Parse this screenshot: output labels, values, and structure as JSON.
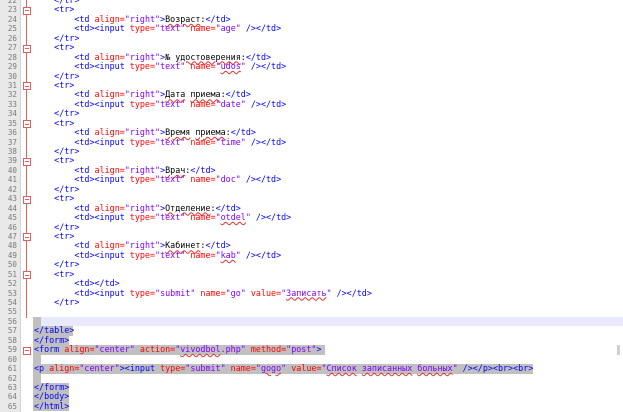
{
  "editor": {
    "lines": [
      {
        "num": "22",
        "marker": "none",
        "hl": "none",
        "sel_w": 0,
        "tokens": [
          {
            "c": "",
            "t": "    "
          },
          {
            "c": "t",
            "t": "</tr>"
          }
        ]
      },
      {
        "num": "23",
        "marker": "fold",
        "hl": "none",
        "sel_w": 0,
        "tokens": [
          {
            "c": "",
            "t": "    "
          },
          {
            "c": "t",
            "t": "<tr>"
          }
        ]
      },
      {
        "num": "24",
        "marker": "none",
        "hl": "none",
        "sel_w": 0,
        "tokens": [
          {
            "c": "",
            "t": "        "
          },
          {
            "c": "t",
            "t": "<td"
          },
          {
            "c": "a",
            "t": " align="
          },
          {
            "c": "s",
            "t": "\"right\""
          },
          {
            "c": "t",
            "t": ">"
          },
          {
            "c": "tx",
            "t": "Возраст:"
          },
          {
            "c": "t",
            "t": "</td>"
          }
        ]
      },
      {
        "num": "25",
        "marker": "none",
        "hl": "none",
        "sel_w": 0,
        "tokens": [
          {
            "c": "",
            "t": "        "
          },
          {
            "c": "t",
            "t": "<td><input"
          },
          {
            "c": "a",
            "t": " type="
          },
          {
            "c": "s",
            "t": "\"text\""
          },
          {
            "c": "a",
            "t": " name="
          },
          {
            "c": "s",
            "t": "\"age\""
          },
          {
            "c": "t",
            "t": " /></td>"
          }
        ]
      },
      {
        "num": "26",
        "marker": "none",
        "hl": "none",
        "sel_w": 0,
        "tokens": [
          {
            "c": "",
            "t": "    "
          },
          {
            "c": "t",
            "t": "</tr>"
          }
        ]
      },
      {
        "num": "27",
        "marker": "fold",
        "hl": "none",
        "sel_w": 0,
        "tokens": [
          {
            "c": "",
            "t": "    "
          },
          {
            "c": "t",
            "t": "<tr>"
          }
        ]
      },
      {
        "num": "28",
        "marker": "none",
        "hl": "none",
        "sel_w": 0,
        "tokens": [
          {
            "c": "",
            "t": "        "
          },
          {
            "c": "t",
            "t": "<td"
          },
          {
            "c": "a",
            "t": " align="
          },
          {
            "c": "s",
            "t": "\"right\""
          },
          {
            "c": "t",
            "t": ">"
          },
          {
            "c": "tx",
            "t": "№ удостоверения:"
          },
          {
            "c": "t",
            "t": "</td>"
          }
        ]
      },
      {
        "num": "29",
        "marker": "none",
        "hl": "none",
        "sel_w": 0,
        "tokens": [
          {
            "c": "",
            "t": "        "
          },
          {
            "c": "t",
            "t": "<td><input"
          },
          {
            "c": "a",
            "t": " type="
          },
          {
            "c": "s",
            "t": "\"text\""
          },
          {
            "c": "a",
            "t": " name="
          },
          {
            "c": "s",
            "t": "\"udos\""
          },
          {
            "c": "t",
            "t": " /></td>"
          }
        ]
      },
      {
        "num": "30",
        "marker": "none",
        "hl": "none",
        "sel_w": 0,
        "tokens": [
          {
            "c": "",
            "t": "    "
          },
          {
            "c": "t",
            "t": "</tr>"
          }
        ]
      },
      {
        "num": "31",
        "marker": "fold",
        "hl": "none",
        "sel_w": 0,
        "tokens": [
          {
            "c": "",
            "t": "    "
          },
          {
            "c": "t",
            "t": "<tr>"
          }
        ]
      },
      {
        "num": "32",
        "marker": "none",
        "hl": "none",
        "sel_w": 0,
        "tokens": [
          {
            "c": "",
            "t": "        "
          },
          {
            "c": "t",
            "t": "<td"
          },
          {
            "c": "a",
            "t": " align="
          },
          {
            "c": "s",
            "t": "\"right\""
          },
          {
            "c": "t",
            "t": ">"
          },
          {
            "c": "tx",
            "t": "Дата приема:"
          },
          {
            "c": "t",
            "t": "</td>"
          }
        ]
      },
      {
        "num": "33",
        "marker": "none",
        "hl": "none",
        "sel_w": 0,
        "tokens": [
          {
            "c": "",
            "t": "        "
          },
          {
            "c": "t",
            "t": "<td><input"
          },
          {
            "c": "a",
            "t": " type="
          },
          {
            "c": "s",
            "t": "\"text\""
          },
          {
            "c": "a",
            "t": " name="
          },
          {
            "c": "s",
            "t": "\"date\""
          },
          {
            "c": "t",
            "t": " /></td>"
          }
        ]
      },
      {
        "num": "34",
        "marker": "none",
        "hl": "none",
        "sel_w": 0,
        "tokens": [
          {
            "c": "",
            "t": "    "
          },
          {
            "c": "t",
            "t": "</tr>"
          }
        ]
      },
      {
        "num": "35",
        "marker": "fold",
        "hl": "none",
        "sel_w": 0,
        "tokens": [
          {
            "c": "",
            "t": "    "
          },
          {
            "c": "t",
            "t": "<tr>"
          }
        ]
      },
      {
        "num": "36",
        "marker": "none",
        "hl": "none",
        "sel_w": 0,
        "tokens": [
          {
            "c": "",
            "t": "        "
          },
          {
            "c": "t",
            "t": "<td"
          },
          {
            "c": "a",
            "t": " align="
          },
          {
            "c": "s",
            "t": "\"right\""
          },
          {
            "c": "t",
            "t": ">"
          },
          {
            "c": "tx",
            "t": "Время приема:"
          },
          {
            "c": "t",
            "t": "</td>"
          }
        ]
      },
      {
        "num": "37",
        "marker": "none",
        "hl": "none",
        "sel_w": 0,
        "tokens": [
          {
            "c": "",
            "t": "        "
          },
          {
            "c": "t",
            "t": "<td><input"
          },
          {
            "c": "a",
            "t": " type="
          },
          {
            "c": "s",
            "t": "\"text\""
          },
          {
            "c": "a",
            "t": " name="
          },
          {
            "c": "s",
            "t": "\"time\""
          },
          {
            "c": "t",
            "t": " /></td>"
          }
        ]
      },
      {
        "num": "38",
        "marker": "none",
        "hl": "none",
        "sel_w": 0,
        "tokens": [
          {
            "c": "",
            "t": "    "
          },
          {
            "c": "t",
            "t": "</tr>"
          }
        ]
      },
      {
        "num": "39",
        "marker": "fold",
        "hl": "none",
        "sel_w": 0,
        "tokens": [
          {
            "c": "",
            "t": "    "
          },
          {
            "c": "t",
            "t": "<tr>"
          }
        ]
      },
      {
        "num": "40",
        "marker": "none",
        "hl": "none",
        "sel_w": 0,
        "tokens": [
          {
            "c": "",
            "t": "        "
          },
          {
            "c": "t",
            "t": "<td"
          },
          {
            "c": "a",
            "t": " align="
          },
          {
            "c": "s",
            "t": "\"right\""
          },
          {
            "c": "t",
            "t": ">"
          },
          {
            "c": "tx",
            "t": "Врач:"
          },
          {
            "c": "t",
            "t": "</td>"
          }
        ]
      },
      {
        "num": "41",
        "marker": "none",
        "hl": "none",
        "sel_w": 0,
        "tokens": [
          {
            "c": "",
            "t": "        "
          },
          {
            "c": "t",
            "t": "<td><input"
          },
          {
            "c": "a",
            "t": " type="
          },
          {
            "c": "s",
            "t": "\"text\""
          },
          {
            "c": "a",
            "t": " name="
          },
          {
            "c": "s",
            "t": "\"doc\""
          },
          {
            "c": "t",
            "t": " /></td>"
          }
        ]
      },
      {
        "num": "42",
        "marker": "none",
        "hl": "none",
        "sel_w": 0,
        "tokens": [
          {
            "c": "",
            "t": "    "
          },
          {
            "c": "t",
            "t": "</tr>"
          }
        ]
      },
      {
        "num": "43",
        "marker": "fold",
        "hl": "none",
        "sel_w": 0,
        "tokens": [
          {
            "c": "",
            "t": "    "
          },
          {
            "c": "t",
            "t": "<tr>"
          }
        ]
      },
      {
        "num": "44",
        "marker": "none",
        "hl": "none",
        "sel_w": 0,
        "tokens": [
          {
            "c": "",
            "t": "        "
          },
          {
            "c": "t",
            "t": "<td"
          },
          {
            "c": "a",
            "t": " align="
          },
          {
            "c": "s",
            "t": "\"right\""
          },
          {
            "c": "t",
            "t": ">"
          },
          {
            "c": "tx",
            "t": "Отделение:"
          },
          {
            "c": "t",
            "t": "</td>"
          }
        ]
      },
      {
        "num": "45",
        "marker": "none",
        "hl": "none",
        "sel_w": 0,
        "tokens": [
          {
            "c": "",
            "t": "        "
          },
          {
            "c": "t",
            "t": "<td><input"
          },
          {
            "c": "a",
            "t": " type="
          },
          {
            "c": "s",
            "t": "\"text\""
          },
          {
            "c": "a",
            "t": " name="
          },
          {
            "c": "s",
            "t": "\"otdel\""
          },
          {
            "c": "t",
            "t": " /></td>"
          }
        ]
      },
      {
        "num": "46",
        "marker": "none",
        "hl": "none",
        "sel_w": 0,
        "tokens": [
          {
            "c": "",
            "t": "    "
          },
          {
            "c": "t",
            "t": "</tr>"
          }
        ]
      },
      {
        "num": "47",
        "marker": "fold",
        "hl": "none",
        "sel_w": 0,
        "tokens": [
          {
            "c": "",
            "t": "    "
          },
          {
            "c": "t",
            "t": "<tr>"
          }
        ]
      },
      {
        "num": "48",
        "marker": "none",
        "hl": "none",
        "sel_w": 0,
        "tokens": [
          {
            "c": "",
            "t": "        "
          },
          {
            "c": "t",
            "t": "<td"
          },
          {
            "c": "a",
            "t": " align="
          },
          {
            "c": "s",
            "t": "\"right\""
          },
          {
            "c": "t",
            "t": ">"
          },
          {
            "c": "tx",
            "t": "Кабинет:"
          },
          {
            "c": "t",
            "t": "</td>"
          }
        ]
      },
      {
        "num": "49",
        "marker": "none",
        "hl": "none",
        "sel_w": 0,
        "tokens": [
          {
            "c": "",
            "t": "        "
          },
          {
            "c": "t",
            "t": "<td><input"
          },
          {
            "c": "a",
            "t": " type="
          },
          {
            "c": "s",
            "t": "\"text\""
          },
          {
            "c": "a",
            "t": " name="
          },
          {
            "c": "s",
            "t": "\"kab\""
          },
          {
            "c": "t",
            "t": " /></td>"
          }
        ]
      },
      {
        "num": "50",
        "marker": "none",
        "hl": "none",
        "sel_w": 0,
        "tokens": [
          {
            "c": "",
            "t": "    "
          },
          {
            "c": "t",
            "t": "</tr>"
          }
        ]
      },
      {
        "num": "51",
        "marker": "fold",
        "hl": "none",
        "sel_w": 0,
        "tokens": [
          {
            "c": "",
            "t": "    "
          },
          {
            "c": "t",
            "t": "<tr>"
          }
        ]
      },
      {
        "num": "52",
        "marker": "none",
        "hl": "none",
        "sel_w": 0,
        "tokens": [
          {
            "c": "",
            "t": "        "
          },
          {
            "c": "t",
            "t": "<td></td>"
          }
        ]
      },
      {
        "num": "53",
        "marker": "none",
        "hl": "none",
        "sel_w": 0,
        "tokens": [
          {
            "c": "",
            "t": "        "
          },
          {
            "c": "t",
            "t": "<td><input"
          },
          {
            "c": "a",
            "t": " type="
          },
          {
            "c": "s",
            "t": "\"submit\""
          },
          {
            "c": "a",
            "t": " name="
          },
          {
            "c": "s",
            "t": "\"go\""
          },
          {
            "c": "a",
            "t": " value="
          },
          {
            "c": "s",
            "t": "\"Записать\""
          },
          {
            "c": "t",
            "t": " /></td>"
          }
        ]
      },
      {
        "num": "54",
        "marker": "none",
        "hl": "none",
        "sel_w": 0,
        "tokens": [
          {
            "c": "",
            "t": "    "
          },
          {
            "c": "t",
            "t": "</tr>"
          }
        ]
      },
      {
        "num": "55",
        "marker": "none",
        "hl": "none",
        "sel_w": 0,
        "tokens": []
      },
      {
        "num": "56",
        "marker": "none",
        "hl": "cur",
        "sel_w": 8,
        "tokens": []
      },
      {
        "num": "57",
        "marker": "none",
        "hl": "sel",
        "sel_w": 40,
        "tokens": [
          {
            "c": "t",
            "t": "</table>"
          }
        ]
      },
      {
        "num": "58",
        "marker": "none",
        "hl": "sel",
        "sel_w": 36,
        "tokens": [
          {
            "c": "t",
            "t": "</form>"
          }
        ]
      },
      {
        "num": "59",
        "marker": "fold",
        "hl": "sel",
        "sel_w": 292,
        "tokens": [
          {
            "c": "t",
            "t": "<form"
          },
          {
            "c": "a",
            "t": " align="
          },
          {
            "c": "s",
            "t": "\"center\""
          },
          {
            "c": "a",
            "t": " action="
          },
          {
            "c": "s",
            "t": "\"vivodbol.php\""
          },
          {
            "c": "a",
            "t": " method="
          },
          {
            "c": "s",
            "t": "\"post\""
          },
          {
            "c": "t",
            "t": ">"
          }
        ]
      },
      {
        "num": "60",
        "marker": "none",
        "hl": "sel",
        "sel_w": 8,
        "tokens": []
      },
      {
        "num": "61",
        "marker": "none",
        "hl": "sel",
        "sel_w": 500,
        "tokens": [
          {
            "c": "t",
            "t": "<p"
          },
          {
            "c": "a",
            "t": " align="
          },
          {
            "c": "s",
            "t": "\"center\""
          },
          {
            "c": "t",
            "t": "><input"
          },
          {
            "c": "a",
            "t": " type="
          },
          {
            "c": "s",
            "t": "\"submit\""
          },
          {
            "c": "a",
            "t": " name="
          },
          {
            "c": "s",
            "t": "\"gogo\""
          },
          {
            "c": "a",
            "t": " value="
          },
          {
            "c": "s",
            "t": "\"Список записанных больных\""
          },
          {
            "c": "t",
            "t": " /></p><br><br>"
          }
        ]
      },
      {
        "num": "62",
        "marker": "none",
        "hl": "sel",
        "sel_w": 8,
        "tokens": []
      },
      {
        "num": "63",
        "marker": "none",
        "hl": "sel",
        "sel_w": 36,
        "tokens": [
          {
            "c": "t",
            "t": "</form>"
          }
        ]
      },
      {
        "num": "64",
        "marker": "none",
        "hl": "sel",
        "sel_w": 36,
        "tokens": [
          {
            "c": "t",
            "t": "</body>"
          }
        ]
      },
      {
        "num": "65",
        "marker": "none",
        "hl": "sel",
        "sel_w": 36,
        "tokens": [
          {
            "c": "t",
            "t": "</html>"
          }
        ]
      }
    ],
    "spellcheck_words": [
      "Возраст",
      "удостоверения",
      "udos",
      "Дата",
      "приема",
      "Время",
      "Врач",
      "Отделение",
      "otdel",
      "Кабинет",
      "kab",
      "Записать",
      "vivodbol",
      "gogo",
      "Список",
      "записанных",
      "больных"
    ]
  }
}
